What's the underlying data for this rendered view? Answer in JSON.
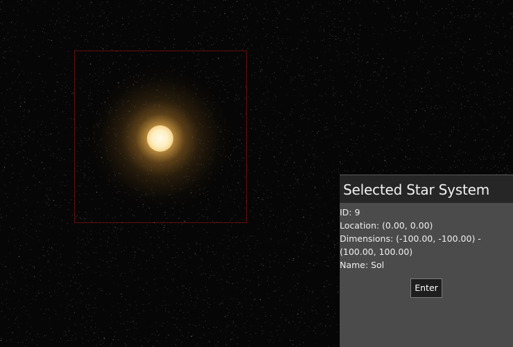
{
  "colors": {
    "space": "#060606",
    "selection_border": "#c01818",
    "star_core": "#fdeec0",
    "star_glow": "#d6a046",
    "panel_bg": "#4b4b4b",
    "panel_header_bg": "#262626",
    "button_bg": "#1e1e1e"
  },
  "star": {
    "icon": "star-sun-icon"
  },
  "panel": {
    "title": "Selected Star System",
    "id_row": "ID: 9",
    "location_row": "Location: (0.00, 0.00)",
    "dimensions_row": "Dimensions: (-100.00, -100.00) - (100.00, 100.00)",
    "name_row": "Name: Sol",
    "enter_label": "Enter"
  }
}
